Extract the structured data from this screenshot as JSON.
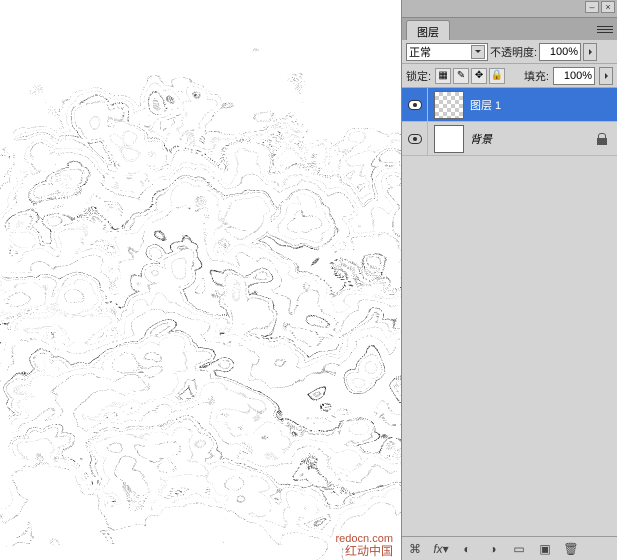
{
  "panel": {
    "tab_label": "图层",
    "blend_mode": "正常",
    "opacity_label": "不透明度:",
    "opacity_value": "100%",
    "lock_label": "锁定:",
    "fill_label": "填充:",
    "fill_value": "100%",
    "lock_icons": [
      "▦",
      "✎",
      "✥",
      "🔒"
    ]
  },
  "layers": [
    {
      "name": "图层 1",
      "visible": true,
      "selected": true,
      "locked": false,
      "transparent": true
    },
    {
      "name": "背景",
      "visible": true,
      "selected": false,
      "locked": true,
      "transparent": false,
      "italic": true
    }
  ],
  "bottom_icons": [
    "link",
    "fx",
    "mask",
    "adjust",
    "folder",
    "new",
    "trash"
  ],
  "watermark": {
    "url": "redocn.com",
    "cn": "红动中国"
  }
}
